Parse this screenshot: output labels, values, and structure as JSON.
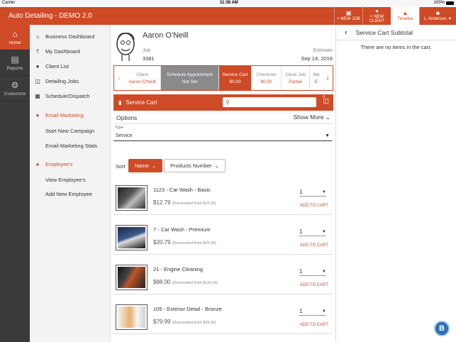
{
  "statusbar": {
    "carrier": "Carrier",
    "time": "11:38 AM",
    "battery": "100%"
  },
  "app": {
    "title": "Auto Detailing - DEMO 2.0"
  },
  "top_actions": [
    {
      "label": "+ NEW JOB",
      "icon": "briefcase-icon"
    },
    {
      "label": "+ NEW CLIENT",
      "icon": "add-user-icon"
    },
    {
      "label": "Timeline",
      "icon": "graduation-cap-icon"
    },
    {
      "label": "L. Anderson",
      "icon": "user-icon"
    }
  ],
  "leftnav": [
    {
      "label": "Home",
      "icon": "home-icon",
      "active": true
    },
    {
      "label": "Reports",
      "icon": "document-icon",
      "active": false
    },
    {
      "label": "Customize",
      "icon": "gear-icon",
      "active": false
    }
  ],
  "submenu": {
    "dashboard": "Business Dashboard",
    "my_dashboard": "My Dashboard",
    "client_list": "Client List",
    "detailing_jobs": "Detailing Jobs",
    "schedule": "Schedule/Dispatch",
    "email_marketing": "Email Marketing",
    "new_campaign": "Start New Campaign",
    "email_stats": "Email Marketing Stats",
    "employees": "Employee's",
    "view_employees": "View Employee's",
    "add_employee": "Add New Employee"
  },
  "customer": {
    "name": "Aaron O'Neill",
    "job_label": "Job",
    "job_number": "3381",
    "estimate_label": "Estimate",
    "estimate_date": "Sep 14, 2016"
  },
  "steps": [
    {
      "label": "Client",
      "value": "Aaron O'Neill",
      "state": "normal"
    },
    {
      "label": "Schedule Appointment",
      "value": "Not Set",
      "state": "dark"
    },
    {
      "label": "Service Cart",
      "value": "$0.00",
      "state": "active"
    },
    {
      "label": "Checkout",
      "value": "$0.00",
      "state": "normal"
    },
    {
      "label": "Close Job",
      "value": "Partial",
      "state": "normal"
    },
    {
      "label": "Ma",
      "value": "E",
      "state": "normal"
    }
  ],
  "service_cart": {
    "title": "Service Cart",
    "search_placeholder": "",
    "count": "0"
  },
  "options": {
    "label": "Options",
    "show_more": "Show More"
  },
  "type_filter": {
    "label": "Type",
    "value": "Service"
  },
  "sort": {
    "label": "Sort",
    "name_button": "Name",
    "products_button": "Products Number"
  },
  "products": [
    {
      "name": "1123 - Car Wash - Basic",
      "price": "$12.79",
      "discount": "(Discounted from $15.99)",
      "qty": "1",
      "add": "ADD TO CART"
    },
    {
      "name": "7 - Car Wash - Premium",
      "price": "$20.79",
      "discount": "(Discounted from $25.99)",
      "qty": "1",
      "add": "ADD TO CART"
    },
    {
      "name": "21 - Engine Cleaning",
      "price": "$88.00",
      "discount": "(Discounted from $110.00)",
      "qty": "1",
      "add": "ADD TO CART"
    },
    {
      "name": "105 - Exterior Detail - Bronze",
      "price": "$79.99",
      "discount": "(Discounted from $99.99)",
      "qty": "1",
      "add": "ADD TO CART"
    }
  ],
  "subtotal": {
    "title": "Service Cart Subtotal",
    "empty": "There are no items in the cart."
  },
  "colors": {
    "accent": "#cf4a26",
    "nav_bg": "#3a3a3a",
    "submenu_bg": "#f3f3f3"
  }
}
